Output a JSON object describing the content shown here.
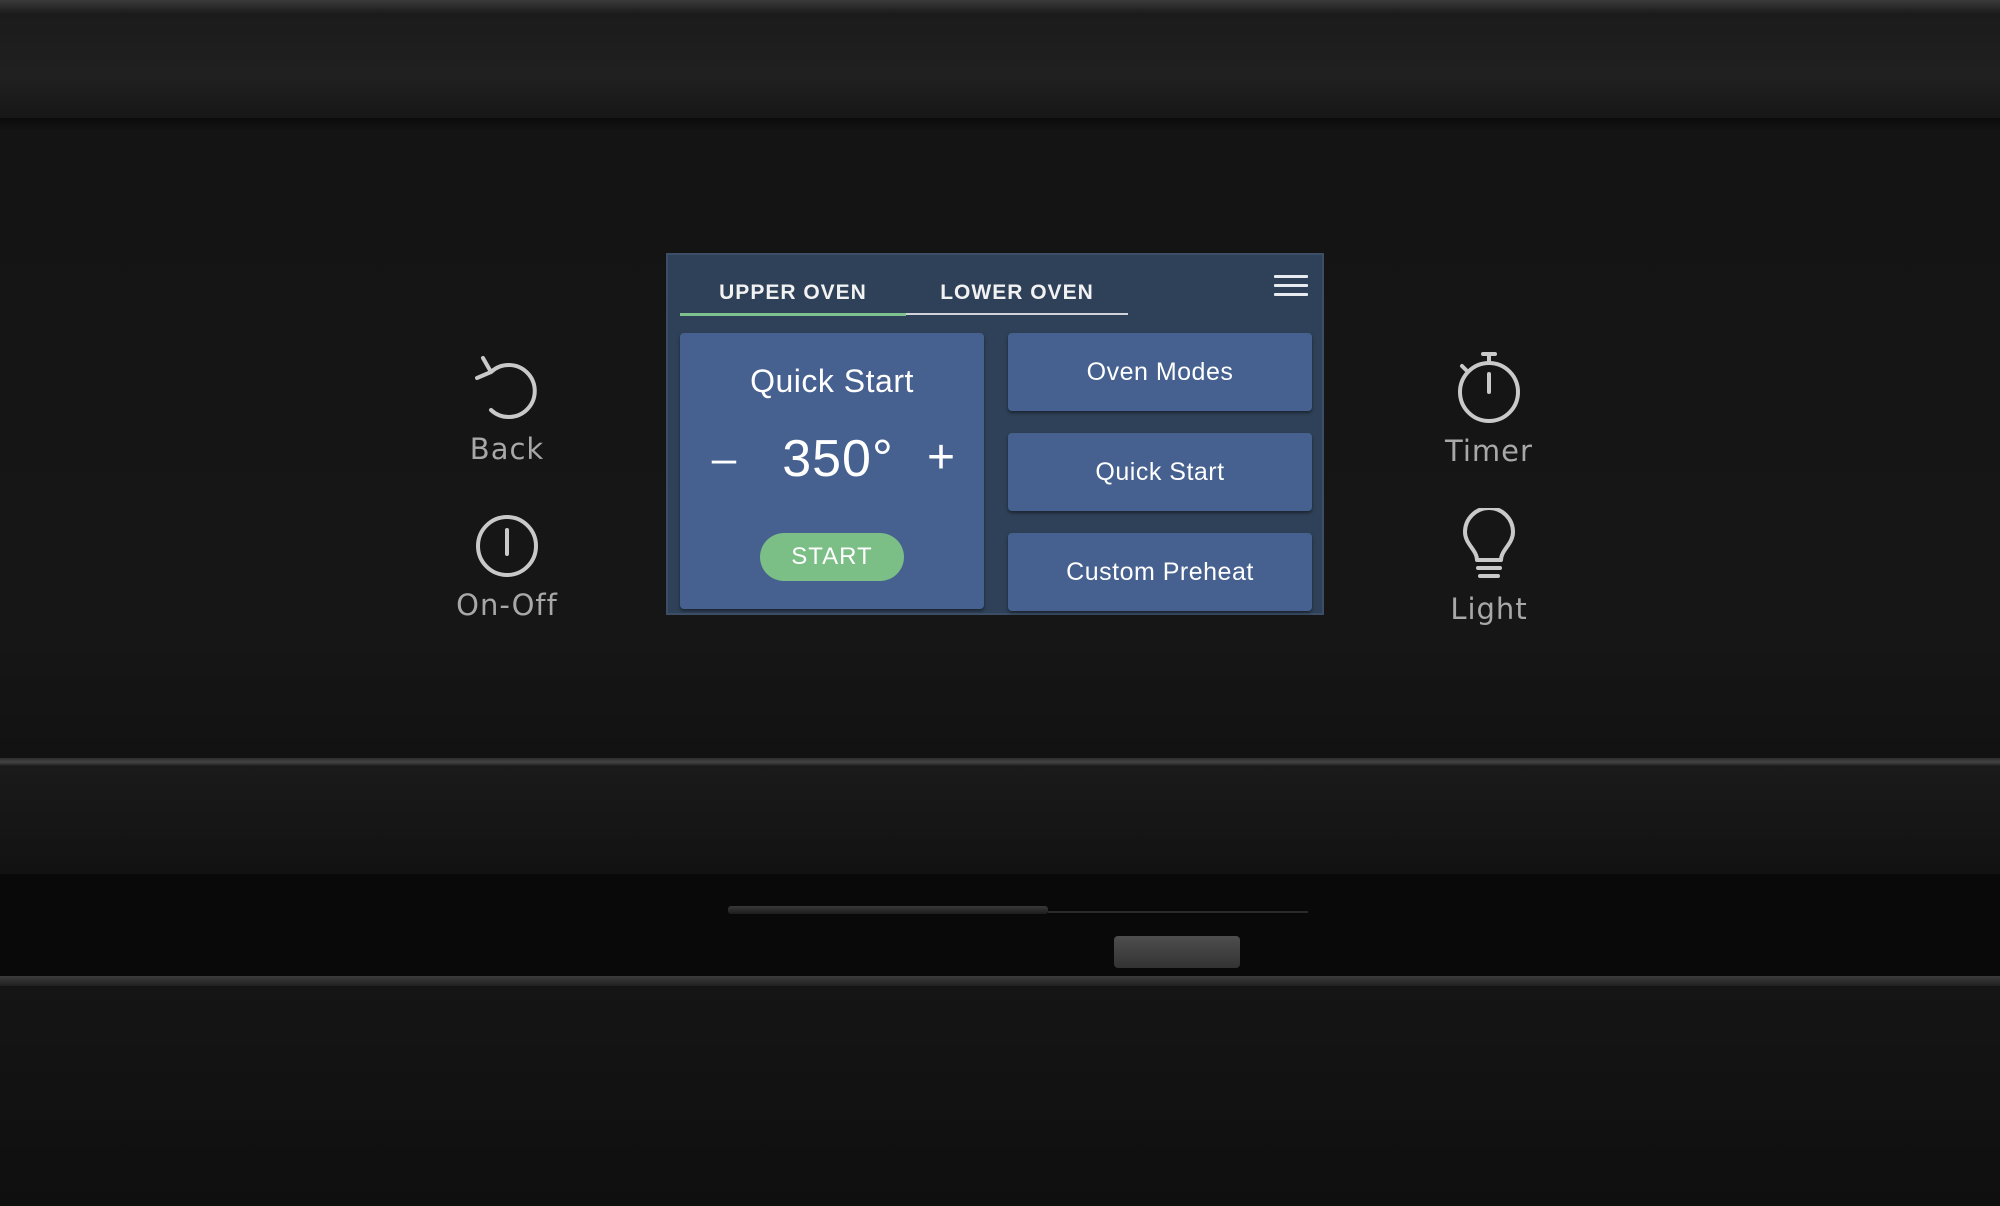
{
  "left_controls": {
    "back": {
      "label": "Back",
      "icon": "back-arrow-icon"
    },
    "on_off": {
      "label": "On-Off",
      "icon": "power-icon"
    }
  },
  "right_controls": {
    "timer": {
      "label": "Timer",
      "icon": "stopwatch-icon"
    },
    "light": {
      "label": "Light",
      "icon": "lightbulb-icon"
    }
  },
  "screen": {
    "tabs": [
      {
        "label": "UPPER OVEN",
        "active": true
      },
      {
        "label": "LOWER OVEN",
        "active": false
      }
    ],
    "menu_icon": "hamburger-menu-icon",
    "quick_start_card": {
      "title": "Quick Start",
      "decrement": "–",
      "temperature": "350°",
      "increment": "+",
      "start_label": "START"
    },
    "buttons": [
      {
        "label": "Oven Modes"
      },
      {
        "label": "Quick Start"
      },
      {
        "label": "Custom Preheat"
      }
    ]
  },
  "colors": {
    "screen_bg": "#2f4158",
    "tile": "#46618f",
    "start_green": "#7cbf86",
    "active_tab_underline": "#7ec28f",
    "panel": "#151515"
  }
}
